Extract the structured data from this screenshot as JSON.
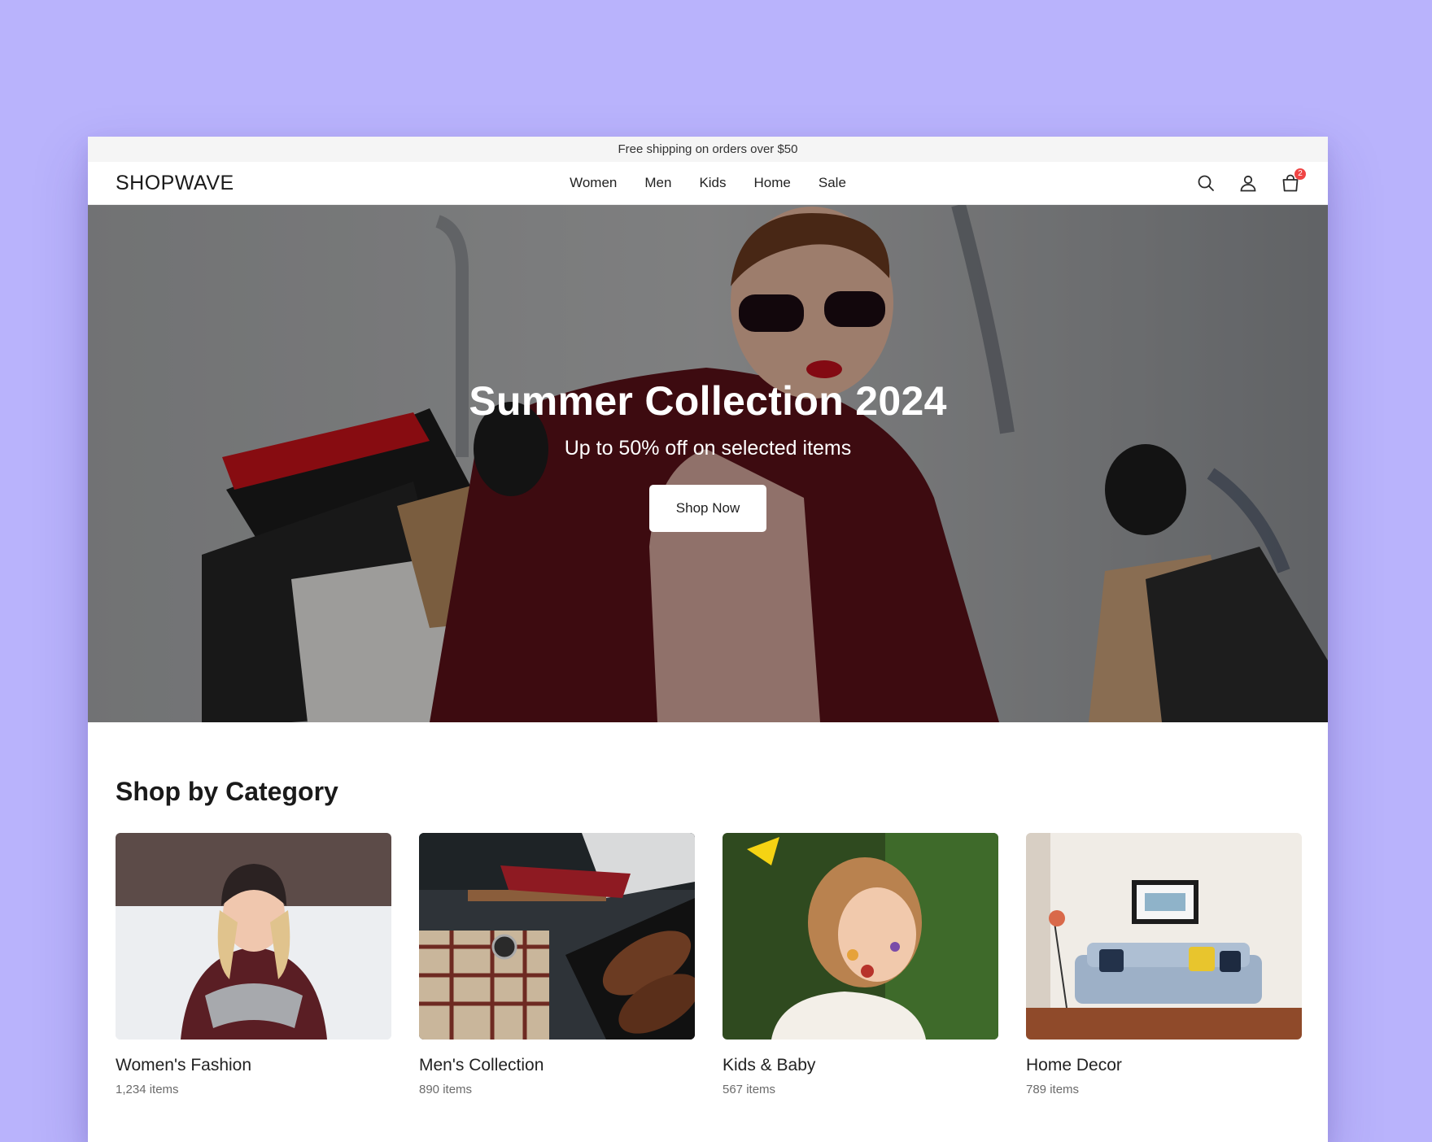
{
  "promo": {
    "text": "Free shipping on orders over $50"
  },
  "header": {
    "logo": "SHOPWAVE",
    "nav": [
      {
        "label": "Women"
      },
      {
        "label": "Men"
      },
      {
        "label": "Kids"
      },
      {
        "label": "Home"
      },
      {
        "label": "Sale"
      }
    ],
    "icons": [
      "search-icon",
      "user-icon",
      "shopping-bag-icon"
    ],
    "cart_count": "2"
  },
  "hero": {
    "title": "Summer Collection 2024",
    "subtitle": "Up to 50% off on selected items",
    "cta": "Shop Now"
  },
  "categories": {
    "title": "Shop by Category",
    "items": [
      {
        "name": "Women's Fashion",
        "count": "1,234 items"
      },
      {
        "name": "Men's Collection",
        "count": "890 items"
      },
      {
        "name": "Kids & Baby",
        "count": "567 items"
      },
      {
        "name": "Home Decor",
        "count": "789 items"
      }
    ]
  },
  "colors": {
    "page_background": "#b9b3fc",
    "promo_background": "#f5f5f5",
    "badge": "#ef4444",
    "text": "#1f1f1f",
    "muted_text": "#6b6b6b"
  }
}
